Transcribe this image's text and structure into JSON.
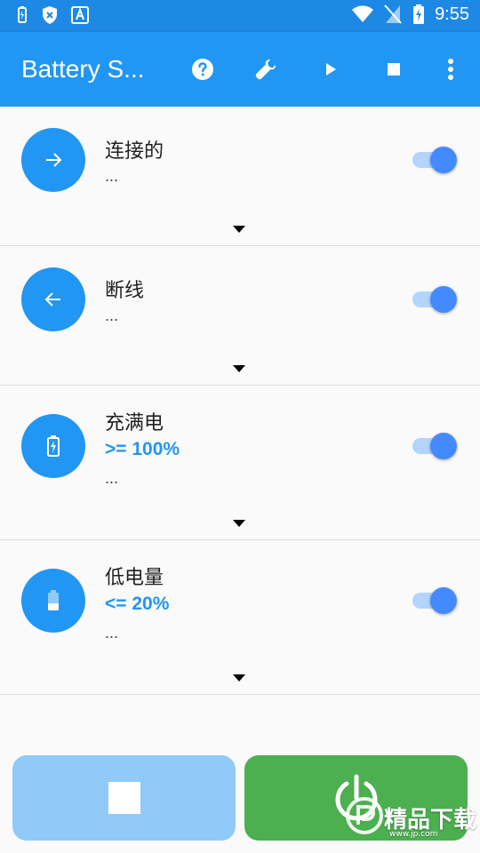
{
  "status_bar": {
    "time": "9:55",
    "left_icons": [
      "battery-saver-icon",
      "shield-x-icon",
      "font-a-icon"
    ],
    "right_icons": [
      "wifi-icon",
      "no-sim-icon",
      "battery-charging-icon"
    ]
  },
  "app_bar": {
    "title": "Battery S...",
    "actions": [
      "help-icon",
      "wrench-icon",
      "play-icon",
      "stop-icon",
      "more-vert-icon"
    ]
  },
  "items": [
    {
      "title": "连接的",
      "subtitle": "",
      "dots": "...",
      "enabled": true,
      "icon": "arrow-right-icon"
    },
    {
      "title": "断线",
      "subtitle": "",
      "dots": "...",
      "enabled": true,
      "icon": "arrow-left-icon"
    },
    {
      "title": "充满电",
      "subtitle": ">= 100%",
      "dots": "...",
      "enabled": true,
      "icon": "battery-charging-icon"
    },
    {
      "title": "低电量",
      "subtitle": "<= 20%",
      "dots": "...",
      "enabled": true,
      "icon": "battery-low-icon"
    }
  ],
  "buttons": {
    "stop": "stop-square-icon",
    "power": "power-icon"
  },
  "watermark": {
    "text": "精品下载",
    "url": "www.jp.com"
  },
  "colors": {
    "status_bar": "#1e88e5",
    "app_bar": "#2196f3",
    "accent": "#2196f3",
    "toggle_thumb": "#448aff",
    "stop_button": "#90caf9",
    "power_button": "#4caf50"
  }
}
